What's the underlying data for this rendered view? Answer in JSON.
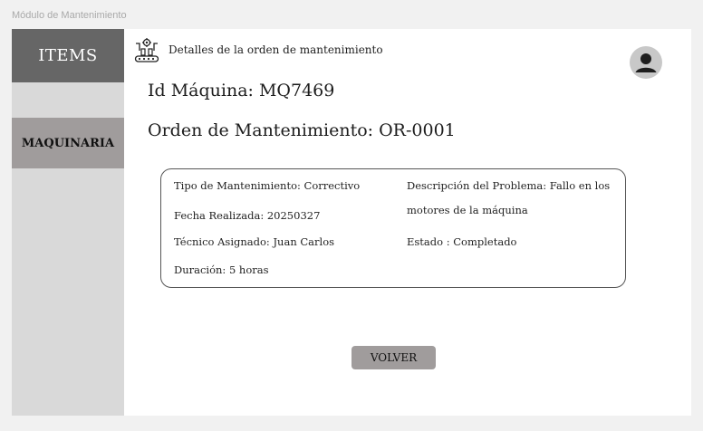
{
  "frame_label": "Módulo de Mantenimiento",
  "sidebar": {
    "items_label": "ITEMS",
    "maquinaria_label": "MAQUINARIA"
  },
  "header": {
    "title": "Detalles de la orden de mantenimiento",
    "icon": "maintenance-conveyor-icon",
    "avatar_icon": "user-avatar-icon"
  },
  "main": {
    "id_maquina": "Id Máquina: MQ7469",
    "orden": "Orden de Mantenimiento: OR-0001"
  },
  "details": {
    "tipo": "Tipo de Mantenimiento: Correctivo",
    "fecha": "Fecha Realizada: 20250327",
    "tecnico": "Técnico Asignado: Juan Carlos",
    "duracion": "Duración: 5 horas",
    "descripcion": "Descripción del Problema: Fallo en los motores de la máquina",
    "estado": "Estado : Completado"
  },
  "actions": {
    "volver": "VOLVER"
  },
  "colors": {
    "sidebar_bg": "#d9d9d9",
    "items_bg": "#666666",
    "active_bg": "#a09c9c",
    "button_bg": "#a09c9c"
  }
}
